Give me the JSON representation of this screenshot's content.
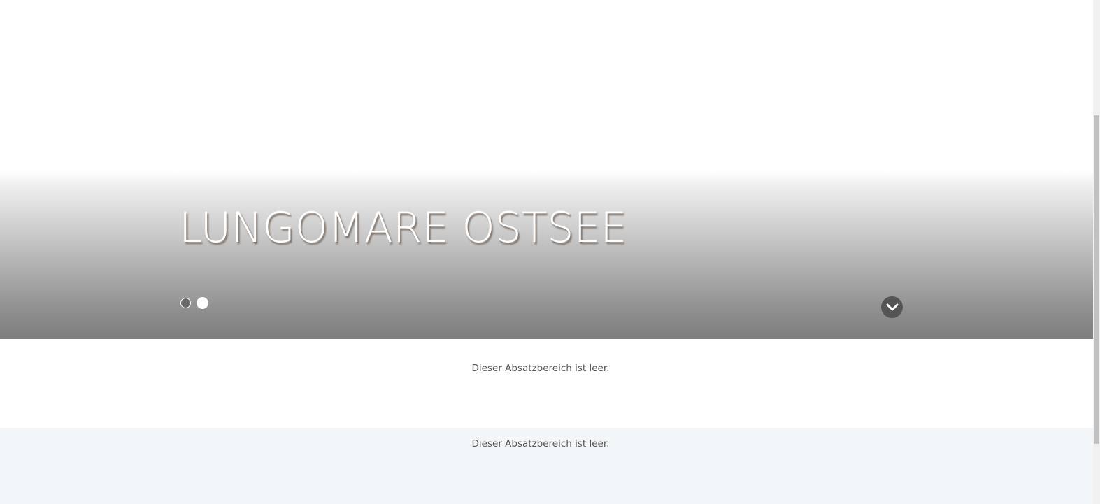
{
  "hero": {
    "title": "LUNGOMARE OSTSEE",
    "slides": [
      {
        "active": false
      },
      {
        "active": true
      }
    ],
    "scroll_down_icon": "chevron-down-icon"
  },
  "sections": [
    {
      "text": "Dieser Absatzbereich ist leer."
    },
    {
      "text": "Dieser Absatzbereich ist leer."
    }
  ],
  "colors": {
    "title_text": "#ffffff",
    "scroll_button": "#555555",
    "section_alt_background": "#f3f6f9",
    "body_text": "#555555"
  }
}
